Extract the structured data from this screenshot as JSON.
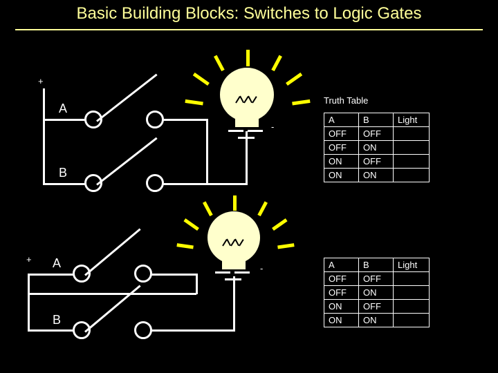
{
  "title": "Basic Building Blocks: Switches to Logic Gates",
  "colors": {
    "title": "#FFFF99",
    "wire": "#FFFFFF",
    "bulb_glass": "#FFFFCC",
    "rays": "#FFFF00",
    "background": "#000000"
  },
  "circuits": [
    {
      "name": "series-circuit",
      "battery_plus": "+",
      "battery_minus": "-",
      "switch_labels": [
        "A",
        "B"
      ],
      "lamp": "light-bulb"
    },
    {
      "name": "parallel-circuit",
      "battery_plus": "+",
      "battery_minus": "-",
      "switch_labels": [
        "A",
        "B"
      ],
      "lamp": "light-bulb"
    }
  ],
  "truth_tables": [
    {
      "caption": "Truth Table",
      "headers": [
        "A",
        "B",
        "Light"
      ],
      "rows": [
        [
          "OFF",
          "OFF",
          ""
        ],
        [
          "OFF",
          "ON",
          ""
        ],
        [
          "ON",
          "OFF",
          ""
        ],
        [
          "ON",
          "ON",
          ""
        ]
      ]
    },
    {
      "caption": "",
      "headers": [
        "A",
        "B",
        "Light"
      ],
      "rows": [
        [
          "OFF",
          "OFF",
          ""
        ],
        [
          "OFF",
          "ON",
          ""
        ],
        [
          "ON",
          "OFF",
          ""
        ],
        [
          "ON",
          "ON",
          ""
        ]
      ]
    }
  ]
}
